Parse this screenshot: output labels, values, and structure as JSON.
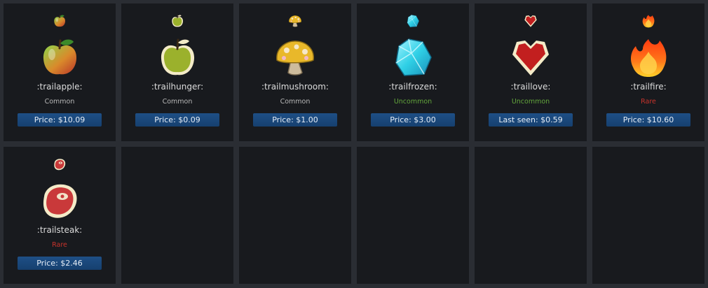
{
  "items": [
    {
      "name": ":trailapple:",
      "rarity": "Common",
      "price": "Price: $10.09",
      "icon": "apple-icon"
    },
    {
      "name": ":trailhunger:",
      "rarity": "Common",
      "price": "Price: $0.09",
      "icon": "green-apple-icon"
    },
    {
      "name": ":trailmushroom:",
      "rarity": "Common",
      "price": "Price: $1.00",
      "icon": "mushroom-icon"
    },
    {
      "name": ":trailfrozen:",
      "rarity": "Uncommon",
      "price": "Price: $3.00",
      "icon": "ice-crystal-icon"
    },
    {
      "name": ":traillove:",
      "rarity": "Uncommon",
      "price": "Last seen: $0.59",
      "icon": "heart-icon"
    },
    {
      "name": ":trailfire:",
      "rarity": "Rare",
      "price": "Price: $10.60",
      "icon": "fire-icon"
    },
    {
      "name": ":trailsteak:",
      "rarity": "Rare",
      "price": "Price: $2.46",
      "icon": "steak-icon"
    }
  ],
  "colors": {
    "background": "#2a2d33",
    "card": "#181a1e",
    "common": "#b8b8b8",
    "uncommon": "#63a63c",
    "rare": "#c8332b",
    "button": "#1e4f86"
  }
}
